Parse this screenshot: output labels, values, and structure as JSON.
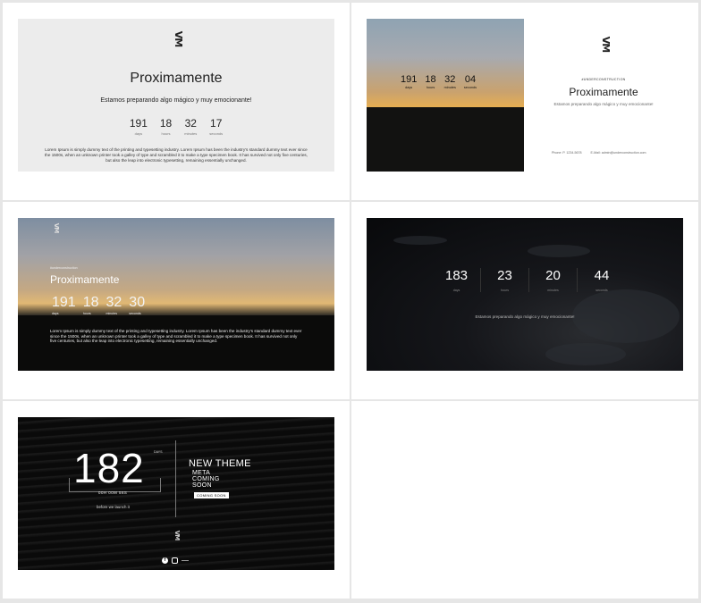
{
  "logo_text": "VM",
  "t1": {
    "title": "Proximamente",
    "subtitle": "Estamos preparando algo mágico y muy emocionante!",
    "countdown": [
      {
        "value": "191",
        "unit": "days"
      },
      {
        "value": "18",
        "unit": "hours"
      },
      {
        "value": "32",
        "unit": "minutes"
      },
      {
        "value": "17",
        "unit": "seconds"
      }
    ],
    "lorem": "Lorem Ipsum is simply dummy text of the printing and typesetting industry. Lorem Ipsum has been the industry's standard dummy text ever since the 1500s, when an unknown printer took a galley of type and scrambled it to make a type specimen book. It has survived not only five centuries, but also the leap into electronic typesetting, remaining essentially unchanged."
  },
  "t2": {
    "countdown": [
      {
        "value": "191",
        "unit": "days"
      },
      {
        "value": "18",
        "unit": "hours"
      },
      {
        "value": "32",
        "unit": "minutes"
      },
      {
        "value": "04",
        "unit": "seconds"
      }
    ],
    "kicker": "#UNDERCONSTRUCTION",
    "title": "Proximamente",
    "subtitle": "Estamos preparando algo mágico y muy emocionante!",
    "phone": "Phone: P. 1234-5678",
    "email": "E-Mail: admin@underconstruction.com"
  },
  "t3": {
    "kicker": "#underconstruction",
    "title": "Proximamente",
    "countdown": [
      {
        "value": "191",
        "unit": "days"
      },
      {
        "value": "18",
        "unit": "hours"
      },
      {
        "value": "32",
        "unit": "minutes"
      },
      {
        "value": "30",
        "unit": "seconds"
      }
    ],
    "lorem": "Lorem Ipsum is simply dummy text of the printing and typesetting industry. Lorem Ipsum has been the industry's standard dummy text ever since the 1500s, when an unknown printer took a galley of type and scrambled it to make a type specimen book. It has survived not only five centuries, but also the leap into electronic typesetting, remaining essentially unchanged."
  },
  "t4": {
    "countdown": [
      {
        "value": "183",
        "unit": "days"
      },
      {
        "value": "23",
        "unit": "hours"
      },
      {
        "value": "20",
        "unit": "minutes"
      },
      {
        "value": "44",
        "unit": "seconds"
      }
    ],
    "subtitle": "Estamos preparando algo mágico y muy emocionante!"
  },
  "t5": {
    "days_value": "182",
    "days_label": "DAYS",
    "time": "00H 00M 56S",
    "before": "before we launch it",
    "heading": "NEW THEME",
    "meta_lines": [
      "META",
      "COMING",
      "SOON"
    ],
    "button": "COMING SOON"
  }
}
